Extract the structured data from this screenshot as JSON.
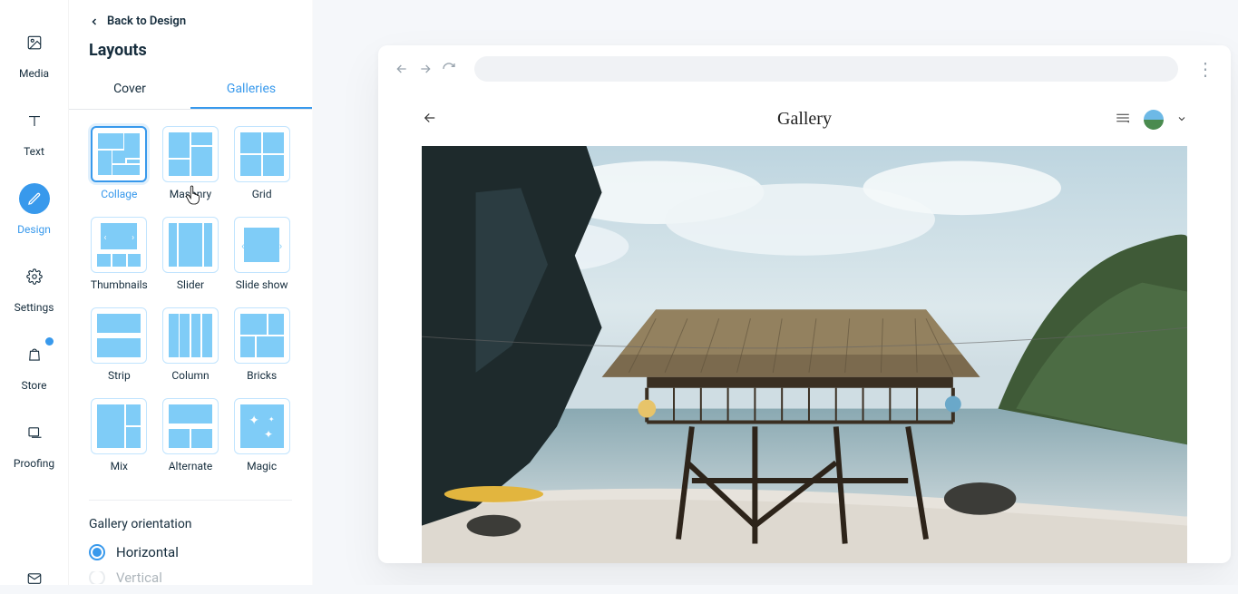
{
  "rail": {
    "items": [
      {
        "name": "media",
        "label": "Media"
      },
      {
        "name": "text",
        "label": "Text"
      },
      {
        "name": "design",
        "label": "Design"
      },
      {
        "name": "settings",
        "label": "Settings"
      },
      {
        "name": "store",
        "label": "Store"
      },
      {
        "name": "proofing",
        "label": "Proofing"
      }
    ],
    "active": "design"
  },
  "panel": {
    "back_label": "Back to Design",
    "title": "Layouts",
    "tabs": {
      "cover": "Cover",
      "galleries": "Galleries",
      "active": "galleries"
    },
    "layouts": [
      "Collage",
      "Masonry",
      "Grid",
      "Thumbnails",
      "Slider",
      "Slide show",
      "Strip",
      "Column",
      "Bricks",
      "Mix",
      "Alternate",
      "Magic"
    ],
    "selected_layout": "Collage",
    "orientation": {
      "title": "Gallery orientation",
      "options": [
        "Horizontal",
        "Vertical"
      ],
      "value": "Horizontal"
    }
  },
  "preview": {
    "page_title": "Gallery"
  }
}
